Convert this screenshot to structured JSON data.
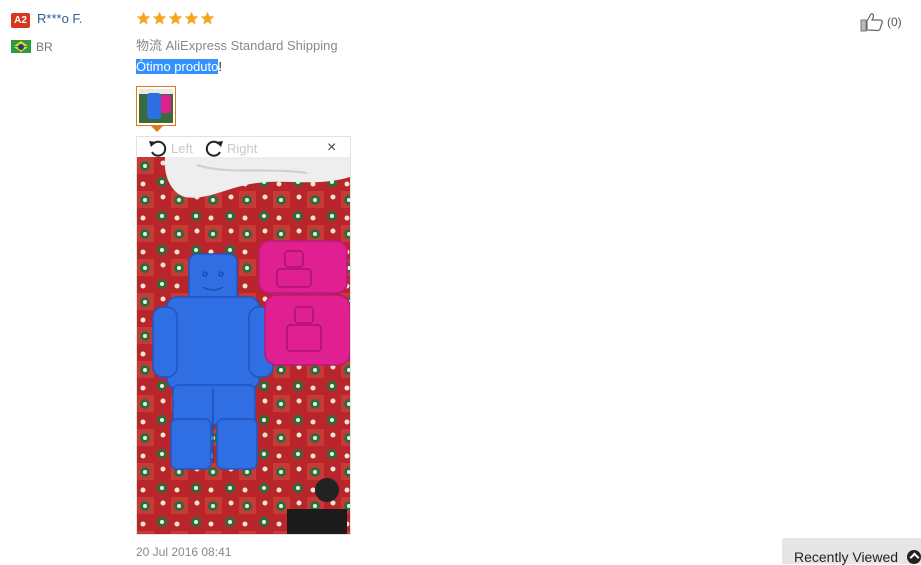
{
  "user": {
    "level_badge": "A2",
    "name": "R***o F.",
    "country_code": "BR",
    "flag_icon": "brazil-flag-icon"
  },
  "review": {
    "rating": 5,
    "rating_max": 5,
    "star_color": "#f5a623",
    "shipping": "物流 AliExpress Standard Shipping",
    "text_selected": "Ótimo produto",
    "text_rest": "!",
    "date": "20 Jul 2016 08:41"
  },
  "viewer": {
    "rotate_left_label": "Left",
    "rotate_right_label": "Right",
    "close_label": "×"
  },
  "helpful": {
    "count": "(0)",
    "icon": "thumbs-up-icon"
  },
  "recently_viewed": {
    "label": "Recently Viewed",
    "icon": "chevron-up-icon"
  },
  "colors": {
    "accent_orange": "#e07b16",
    "selection_blue": "#3392ff",
    "badge_red": "#d6381f",
    "link_blue": "#2a5f8f"
  }
}
